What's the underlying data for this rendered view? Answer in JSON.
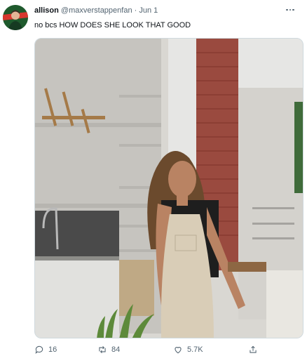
{
  "tweet": {
    "author": {
      "display_name": "allison",
      "handle": "@maxverstappenfan",
      "separator": "·",
      "date": "Jun 1",
      "avatar_icon": "profile-avatar"
    },
    "text": "no bcs HOW DOES SHE LOOK THAT GOOD",
    "actions": {
      "reply_count": "16",
      "retweet_count": "84",
      "like_count": "5.7K"
    },
    "icons": [
      "more-icon",
      "reply-icon",
      "retweet-icon",
      "like-icon",
      "share-icon"
    ]
  }
}
